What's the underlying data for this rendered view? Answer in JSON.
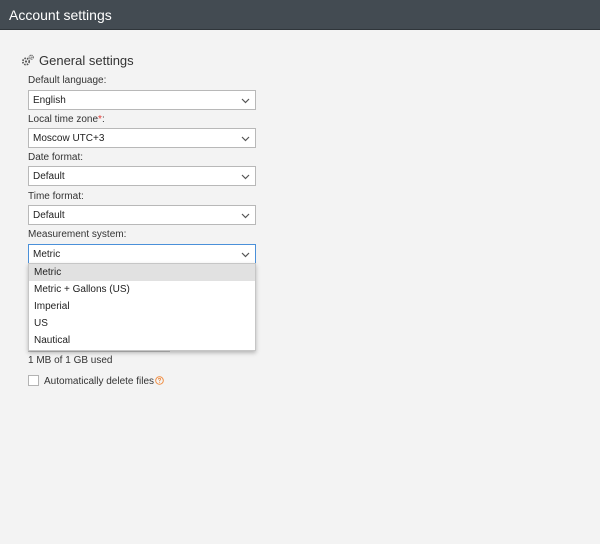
{
  "header": {
    "title": "Account settings"
  },
  "section": {
    "title": "General settings",
    "icon": "gears-icon"
  },
  "fields": {
    "language": {
      "label": "Default language:",
      "value": "English"
    },
    "timezone": {
      "label": "Local time zone",
      "required_mark": "*",
      "suffix": ":",
      "value": "Moscow UTC+3"
    },
    "date_format": {
      "label": "Date format:",
      "value": "Default"
    },
    "time_format": {
      "label": "Time format:",
      "value": "Default"
    },
    "measurement": {
      "label": "Measurement system:",
      "value": "Metric",
      "options": [
        "Metric",
        "Metric + Gallons (US)",
        "Imperial",
        "US",
        "Nautical"
      ],
      "selected_index": 0
    }
  },
  "storage": {
    "usage_text": "1 MB of 1 GB used"
  },
  "auto_delete": {
    "label": "Automatically delete files",
    "checked": false,
    "help_icon": "question-circle-icon"
  },
  "colors": {
    "header_bg": "#434b52",
    "required": "#e53935",
    "help": "#f0883a",
    "focus": "#4a90d9"
  }
}
